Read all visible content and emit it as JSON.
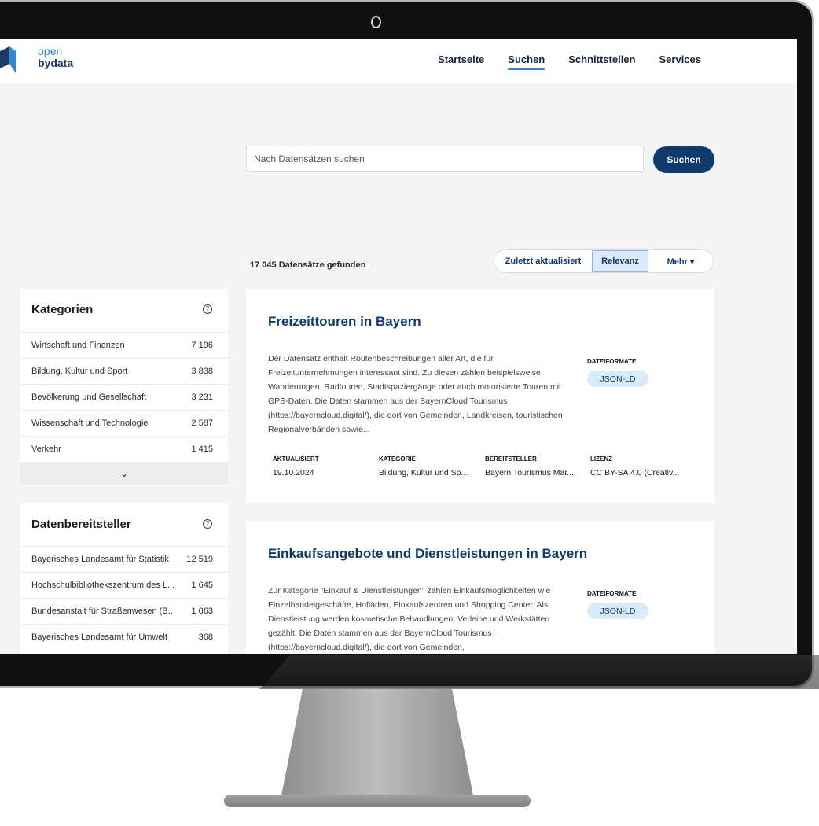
{
  "header": {
    "logo_top": "open",
    "logo_bottom": "bydata",
    "nav": [
      {
        "label": "Startseite"
      },
      {
        "label": "Suchen"
      },
      {
        "label": "Schnittstellen"
      },
      {
        "label": "Services"
      }
    ]
  },
  "search": {
    "placeholder": "Nach Datensätzen suchen",
    "button_label": "Suchen"
  },
  "results": {
    "count_text": "17 045 Datensätze gefunden",
    "sort": {
      "recent": "Zuletzt aktualisiert",
      "relevance": "Relevanz",
      "more": "Mehr ▾"
    }
  },
  "sidebar": {
    "categories": {
      "title": "Kategorien",
      "help_glyph": "?",
      "items": [
        {
          "label": "Wirtschaft und Finanzen",
          "count": "7 196"
        },
        {
          "label": "Bildung, Kultur und Sport",
          "count": "3 838"
        },
        {
          "label": "Bevölkerung und Gesellschaft",
          "count": "3 231"
        },
        {
          "label": "Wissenschaft und Technologie",
          "count": "2 587"
        },
        {
          "label": "Verkehr",
          "count": "1 415"
        }
      ],
      "expand_glyph": "⌄"
    },
    "providers": {
      "title": "Datenbereitsteller",
      "help_glyph": "?",
      "items": [
        {
          "label": "Bayerisches Landesamt für Statistik",
          "count": "12 519"
        },
        {
          "label": "Hochschulbibliothekszentrum des L...",
          "count": "1 645"
        },
        {
          "label": "Bundesanstalt für Straßenwesen (B...",
          "count": "1 063"
        },
        {
          "label": "Bayerisches Landesamt für Umwelt",
          "count": "368"
        }
      ]
    }
  },
  "cards": [
    {
      "title": "Freizeittouren in Bayern",
      "description": "Der Datensatz enthält Routenbeschreibungen aller Art, die für Freizeitunternehmungen interessant sind. Zu diesen zählen beispielsweise Wanderungen, Radtouren, Stadtspaziergänge oder auch motorisierte Touren mit GPS-Daten. Die Daten stammen aus der BayernCloud Tourismus (https://bayerncloud.digital/), die dort von Gemeinden, Landkreisen, touristischen Regionalverbänden sowie...",
      "formats_label": "DATEIFORMATE",
      "format": "JSON-LD",
      "meta": {
        "updated_label": "AKTUALISIERT",
        "updated": "19.10.2024",
        "category_label": "KATEGORIE",
        "category": "Bildung, Kultur und Sp...",
        "provider_label": "BEREITSTELLER",
        "provider": "Bayern Tourismus Mar...",
        "license_label": "LIZENZ",
        "license": "CC BY-SA 4.0 (Creativ..."
      }
    },
    {
      "title": "Einkaufsangebote und Dienstleistungen in Bayern",
      "description": "Zur Kategorie \"Einkauf & Dienstleistungen\" zählen Einkaufsmöglichkeiten wie Einzelhandelgeschäfte, Hofläden, Einkaufszentren und Shopping Center. Als Dienstleistung werden kosmetische Behandlungen, Verleihe und Werkstätten gezählt. Die Daten stammen aus der BayernCloud Tourismus (https://bayerncloud.digital/), die dort von Gemeinden,",
      "formats_label": "DATEIFORMATE",
      "format": "JSON-LD"
    }
  ]
}
